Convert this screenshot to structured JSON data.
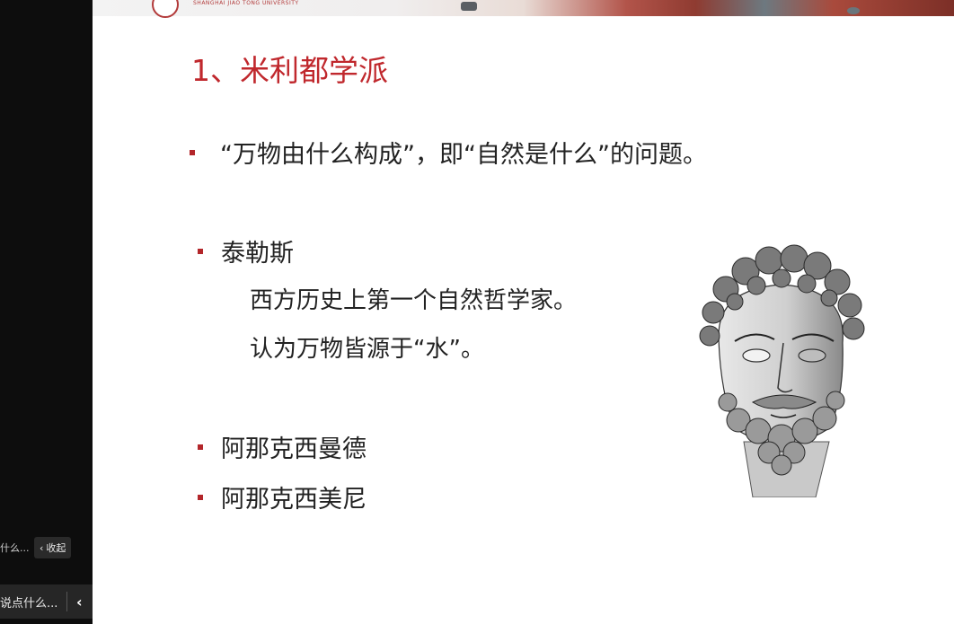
{
  "left_panel": {
    "chip_text": "什么...",
    "collapse_label": "收起",
    "bottom_text": "说点什么..."
  },
  "banner": {
    "university_text": "SHANGHAI JIAO TONG UNIVERSITY"
  },
  "slide": {
    "title": "1、米利都学派",
    "bullets": [
      {
        "text": "“万物由什么构成”，即“自然是什么”的问题。"
      },
      {
        "text": "泰勒斯"
      },
      {
        "text": "阿那克西曼德"
      },
      {
        "text": "阿那克西美尼"
      }
    ],
    "thales_lines": [
      "西方历史上第一个自然哲学家。",
      "认为万物皆源于“水”。"
    ]
  },
  "colors": {
    "title": "#c0282d",
    "bullet_mark": "#b3262a",
    "body_text": "#222222"
  },
  "icons": {
    "chip_chevron": "chevron-left-icon",
    "bottom_chevron": "chevron-left-icon",
    "portrait": "thales-portrait-engraving"
  }
}
